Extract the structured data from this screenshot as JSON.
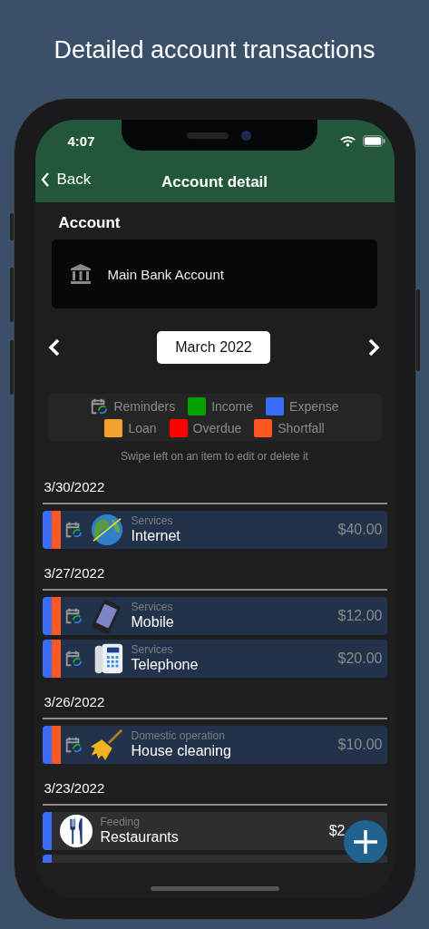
{
  "headline": "Detailed account transactions",
  "status_bar": {
    "time": "4:07"
  },
  "nav": {
    "back": "Back",
    "title": "Account detail"
  },
  "account": {
    "label": "Account",
    "name": "Main Bank Account"
  },
  "month": {
    "value": "March 2022"
  },
  "legend": [
    {
      "kind": "reminder",
      "label": "Reminders"
    },
    {
      "kind": "swatch",
      "label": "Income",
      "color": "#00a000"
    },
    {
      "kind": "swatch",
      "label": "Expense",
      "color": "#3a6cf5"
    },
    {
      "kind": "swatch",
      "label": "Loan",
      "color": "#f2a12e"
    },
    {
      "kind": "swatch",
      "label": "Overdue",
      "color": "#ff0000"
    },
    {
      "kind": "swatch",
      "label": "Shortfall",
      "color": "#ff5722"
    }
  ],
  "hint": "Swipe left on an item to edit or delete it",
  "groups": [
    {
      "date": "3/30/2022",
      "items": [
        {
          "bars": [
            {
              "color": "#3a6cf5"
            },
            {
              "color": "#ff5722"
            }
          ],
          "reminder": true,
          "kind": "globe",
          "category": "Services",
          "name": "Internet",
          "amount": "$40.00"
        }
      ]
    },
    {
      "date": "3/27/2022",
      "items": [
        {
          "bars": [
            {
              "color": "#3a6cf5"
            },
            {
              "color": "#ff5722"
            }
          ],
          "reminder": true,
          "kind": "mobile",
          "category": "Services",
          "name": "Mobile",
          "amount": "$12.00"
        },
        {
          "bars": [
            {
              "color": "#3a6cf5"
            },
            {
              "color": "#ff5722"
            }
          ],
          "reminder": true,
          "kind": "telephone",
          "category": "Services",
          "name": "Telephone",
          "amount": "$20.00"
        }
      ]
    },
    {
      "date": "3/26/2022",
      "items": [
        {
          "bars": [
            {
              "color": "#3a6cf5"
            },
            {
              "color": "#ff5722"
            }
          ],
          "reminder": true,
          "kind": "broom",
          "category": "Domestic operation",
          "name": "House cleaning",
          "amount": "$10.00"
        }
      ]
    },
    {
      "date": "3/23/2022",
      "items": [
        {
          "bars": [
            {
              "color": "#3a6cf5"
            }
          ],
          "reminder": false,
          "kind": "cutlery",
          "category": "Feeding",
          "name": "Restaurants",
          "amount": "$2"
        },
        {
          "bars": [
            {
              "color": "#3a6cf5"
            }
          ],
          "reminder": false,
          "kind": "cut-off"
        }
      ]
    }
  ]
}
